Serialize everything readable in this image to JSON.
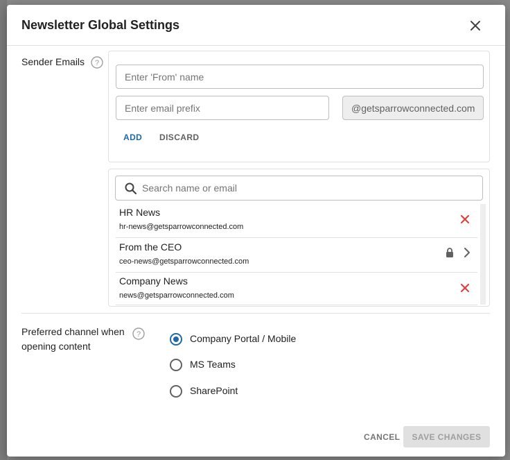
{
  "dialog": {
    "title": "Newsletter Global Settings",
    "close_icon": "close-icon"
  },
  "sender_emails": {
    "label": "Sender Emails",
    "help_icon": "help-circle-icon",
    "from_name_placeholder": "Enter 'From' name",
    "email_prefix_placeholder": "Enter email prefix",
    "domain_suffix": "@getsparrowconnected.com",
    "add_label": "ADD",
    "discard_label": "DISCARD",
    "search_placeholder": "Search name or email",
    "search_icon": "search-icon",
    "senders": [
      {
        "name": "HR News",
        "email": "hr-news@getsparrowconnected.com",
        "action_icon": "remove-x-icon"
      },
      {
        "name": "From the CEO",
        "email": "ceo-news@getsparrowconnected.com",
        "action_icon": "lock-icon"
      },
      {
        "name": "Company News",
        "email": "news@getsparrowconnected.com",
        "action_icon": "remove-x-icon"
      }
    ]
  },
  "preferred_channel": {
    "label_line1": "Preferred channel when",
    "label_line2": "opening content",
    "help_icon": "help-circle-icon",
    "options": [
      {
        "label": "Company Portal / Mobile",
        "selected": true
      },
      {
        "label": "MS Teams",
        "selected": false
      },
      {
        "label": "SharePoint",
        "selected": false
      }
    ]
  },
  "footer": {
    "cancel_label": "CANCEL",
    "save_label": "SAVE CHANGES"
  },
  "colors": {
    "accent": "#1e6aa8",
    "remove": "#e53935",
    "disabled_bg": "#e0e0e0"
  }
}
